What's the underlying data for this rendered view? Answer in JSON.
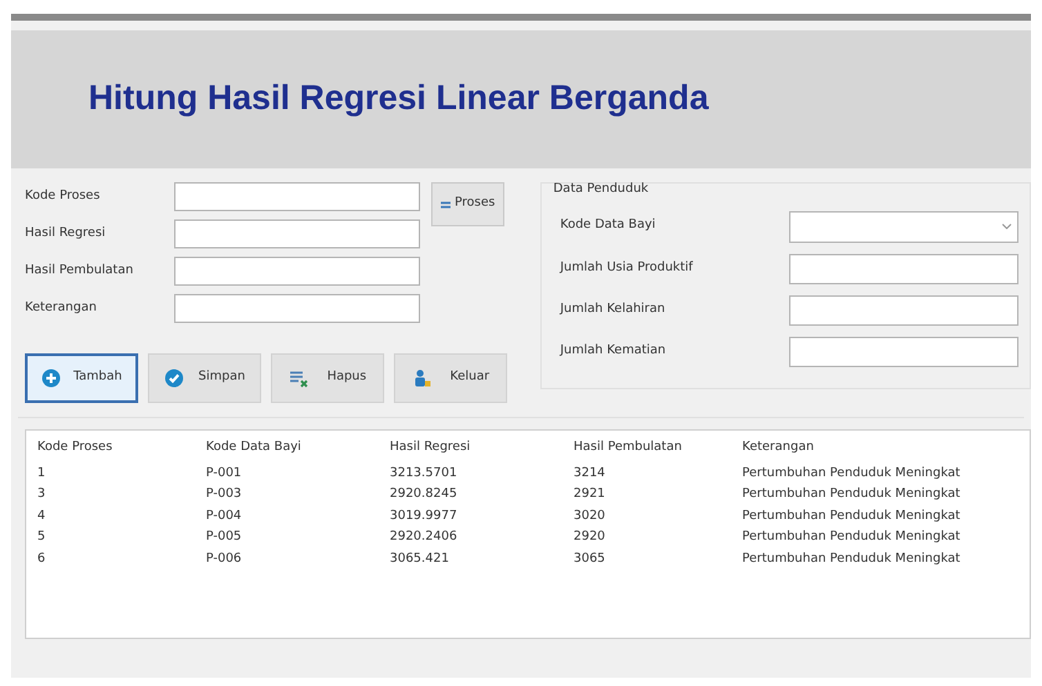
{
  "header": {
    "title": "Hitung Hasil Regresi Linear Berganda"
  },
  "form_fields": [
    {
      "label": "Kode Proses"
    },
    {
      "label": "Hasil Regresi"
    },
    {
      "label": "Hasil Pembulatan"
    },
    {
      "label": "Keterangan"
    }
  ],
  "process_button": {
    "label": "Proses"
  },
  "population_panel": {
    "title": "Data Penduduk",
    "fields": [
      {
        "label": "Kode Data Bayi",
        "kind": "dropdown"
      },
      {
        "label": "Jumlah Usia Produktif",
        "kind": "text"
      },
      {
        "label": "Jumlah Kelahiran",
        "kind": "text"
      },
      {
        "label": "Jumlah Kematian",
        "kind": "text"
      }
    ]
  },
  "action_buttons": [
    {
      "label": "Tambah",
      "kind": "add",
      "selected": true
    },
    {
      "label": "Simpan",
      "kind": "save",
      "selected": false
    },
    {
      "label": "Hapus",
      "kind": "delete",
      "selected": false
    },
    {
      "label": "Keluar",
      "kind": "exit",
      "selected": false
    }
  ],
  "table": {
    "columns": [
      "Kode Proses",
      "Kode Data Bayi",
      "Hasil Regresi",
      "Hasil Pembulatan",
      "Keterangan"
    ],
    "rows": [
      [
        "1",
        "P-001",
        "3213.5701",
        "3214",
        "Pertumbuhan Penduduk Meningkat"
      ],
      [
        "3",
        "P-003",
        "2920.8245",
        "2921",
        "Pertumbuhan Penduduk Meningkat"
      ],
      [
        "4",
        "P-004",
        "3019.9977",
        "3020",
        "Pertumbuhan Penduduk Meningkat"
      ],
      [
        "5",
        "P-005",
        "2920.2406",
        "2920",
        "Pertumbuhan Penduduk Meningkat"
      ],
      [
        "6",
        "P-006",
        "3065.421",
        "3065",
        "Pertumbuhan Penduduk Meningkat"
      ]
    ]
  }
}
